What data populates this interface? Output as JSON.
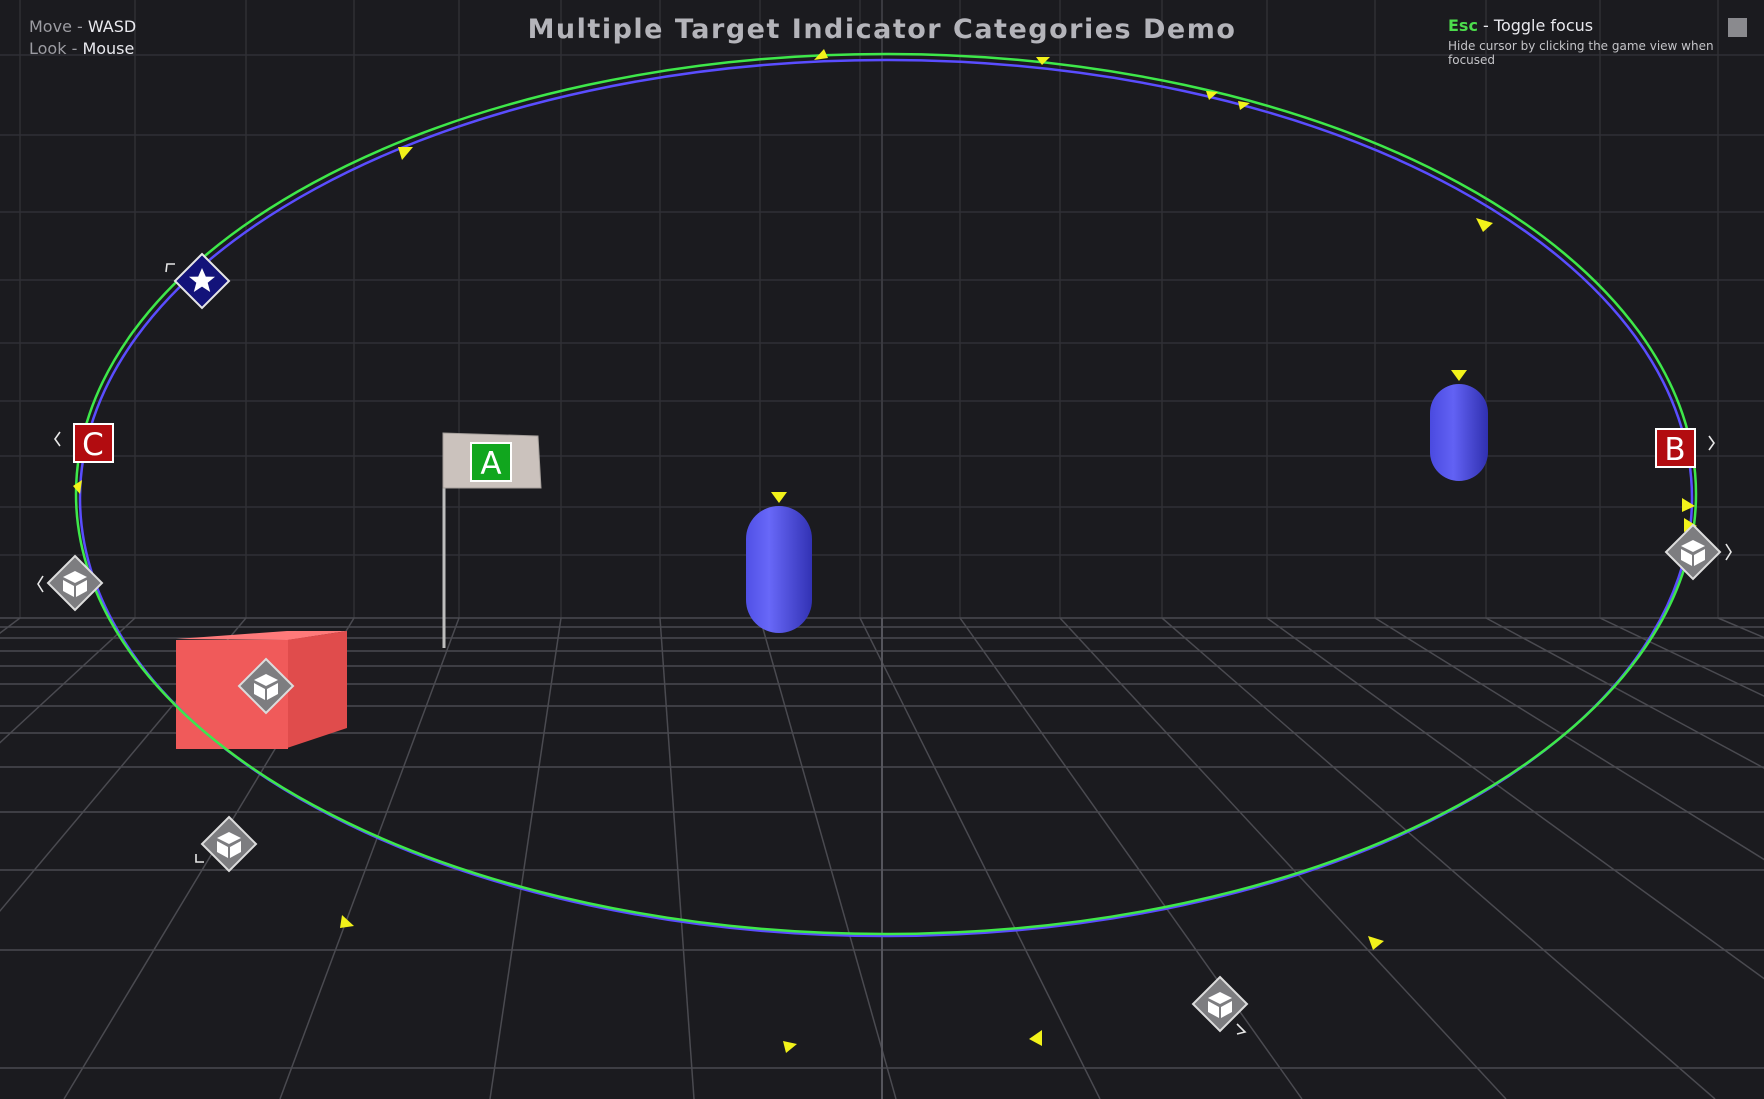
{
  "hud": {
    "title": "Multiple Target Indicator Categories Demo",
    "controls": [
      {
        "label": "Move",
        "separator": " - ",
        "key": "WASD"
      },
      {
        "label": "Look",
        "separator": " - ",
        "key": "Mouse"
      }
    ],
    "focus": {
      "key": "Esc",
      "separator": " - ",
      "action": "Toggle focus"
    },
    "hint": "Hide cursor by clicking the game view when focused"
  },
  "markers": {
    "letters": {
      "a": "A",
      "b": "B",
      "c": "C"
    },
    "star_icon": "star-icon",
    "cube_icon": "cube-icon",
    "arrow_icon": "triangle-arrow-icon"
  },
  "colors": {
    "background": "#1b1b1f",
    "ring_green": "#3ee84a",
    "ring_blue": "#5a4dff",
    "arrow_yellow": "#f2f21a",
    "marker_red": "#b20c10",
    "marker_green": "#11a61e",
    "marker_navy": "#13137a",
    "marker_gray": "#7d7d80",
    "capsule_blue": "#5c5cf0",
    "cube_red": "#f05a5a",
    "flag_cloth": "#cbc2bd"
  }
}
